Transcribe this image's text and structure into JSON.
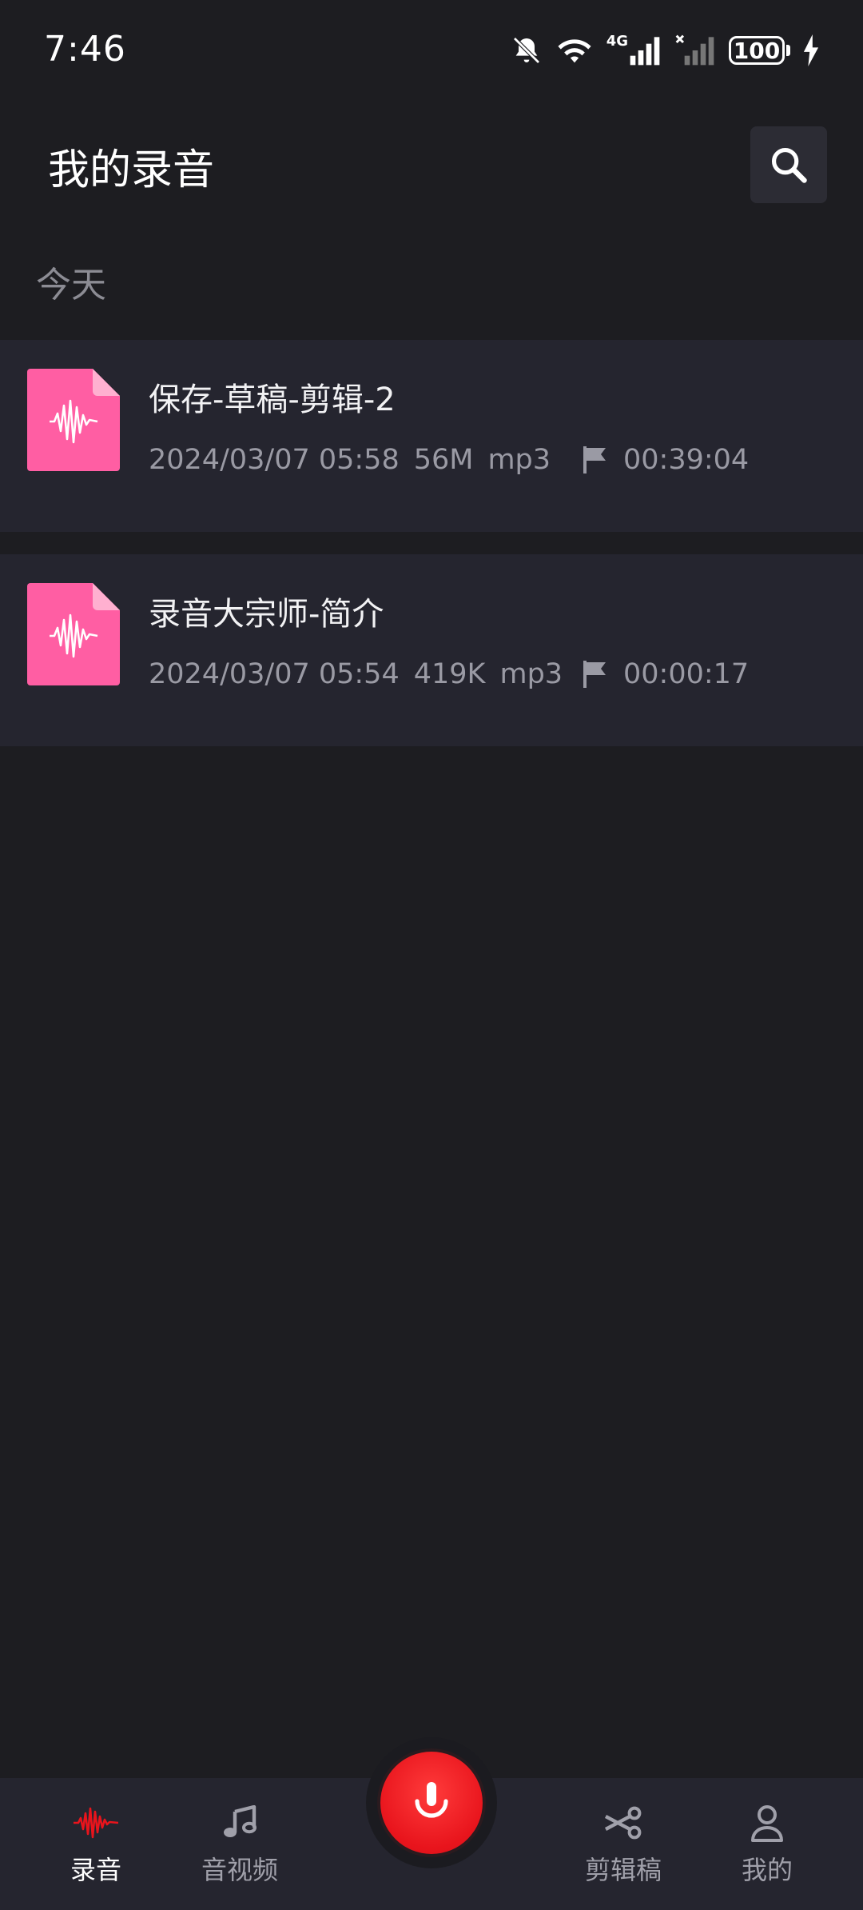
{
  "status_bar": {
    "time": "7:46",
    "network": "4G",
    "battery": "100"
  },
  "header": {
    "title": "我的录音"
  },
  "section": {
    "today_label": "今天"
  },
  "recordings": [
    {
      "title": "保存-草稿-剪辑-2",
      "datetime": "2024/03/07 05:58",
      "size": "56M",
      "format": "mp3",
      "duration": "00:39:04"
    },
    {
      "title": "录音大宗师-简介",
      "datetime": "2024/03/07 05:54",
      "size": "419K",
      "format": "mp3",
      "duration": "00:00:17"
    }
  ],
  "bottom_nav": {
    "items": [
      {
        "label": "录音",
        "icon": "waveform-icon",
        "active": true
      },
      {
        "label": "音视频",
        "icon": "music-note-icon",
        "active": false
      },
      {
        "label": "剪辑稿",
        "icon": "scissors-icon",
        "active": false
      },
      {
        "label": "我的",
        "icon": "person-icon",
        "active": false
      }
    ]
  },
  "colors": {
    "background": "#1d1d21",
    "card": "#25252f",
    "accent_red": "#e8141c",
    "file_icon_pink": "#ff5ea3"
  }
}
